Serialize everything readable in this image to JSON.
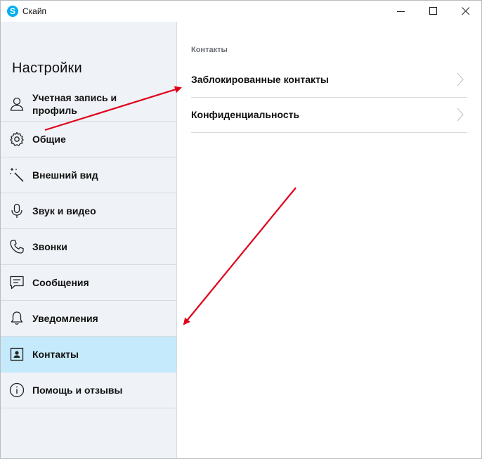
{
  "window": {
    "title": "Скайп"
  },
  "sidebar": {
    "title": "Настройки",
    "items": [
      {
        "label": "Учетная запись и профиль",
        "icon": "person-icon"
      },
      {
        "label": "Общие",
        "icon": "gear-icon"
      },
      {
        "label": "Внешний вид",
        "icon": "magic-wand-icon"
      },
      {
        "label": "Звук и видео",
        "icon": "microphone-icon"
      },
      {
        "label": "Звонки",
        "icon": "phone-icon"
      },
      {
        "label": "Сообщения",
        "icon": "message-icon"
      },
      {
        "label": "Уведомления",
        "icon": "bell-icon"
      },
      {
        "label": "Контакты",
        "icon": "contact-card-icon",
        "active": true
      },
      {
        "label": "Помощь и отзывы",
        "icon": "info-icon"
      }
    ]
  },
  "main": {
    "section_title": "Контакты",
    "rows": [
      {
        "label": "Заблокированные контакты"
      },
      {
        "label": "Конфиденциальность"
      }
    ]
  },
  "colors": {
    "accent_arrow": "#e0001a",
    "active_item_bg": "#c5eafb",
    "sidebar_bg": "#eff2f7",
    "skype_blue": "#00aff0"
  }
}
